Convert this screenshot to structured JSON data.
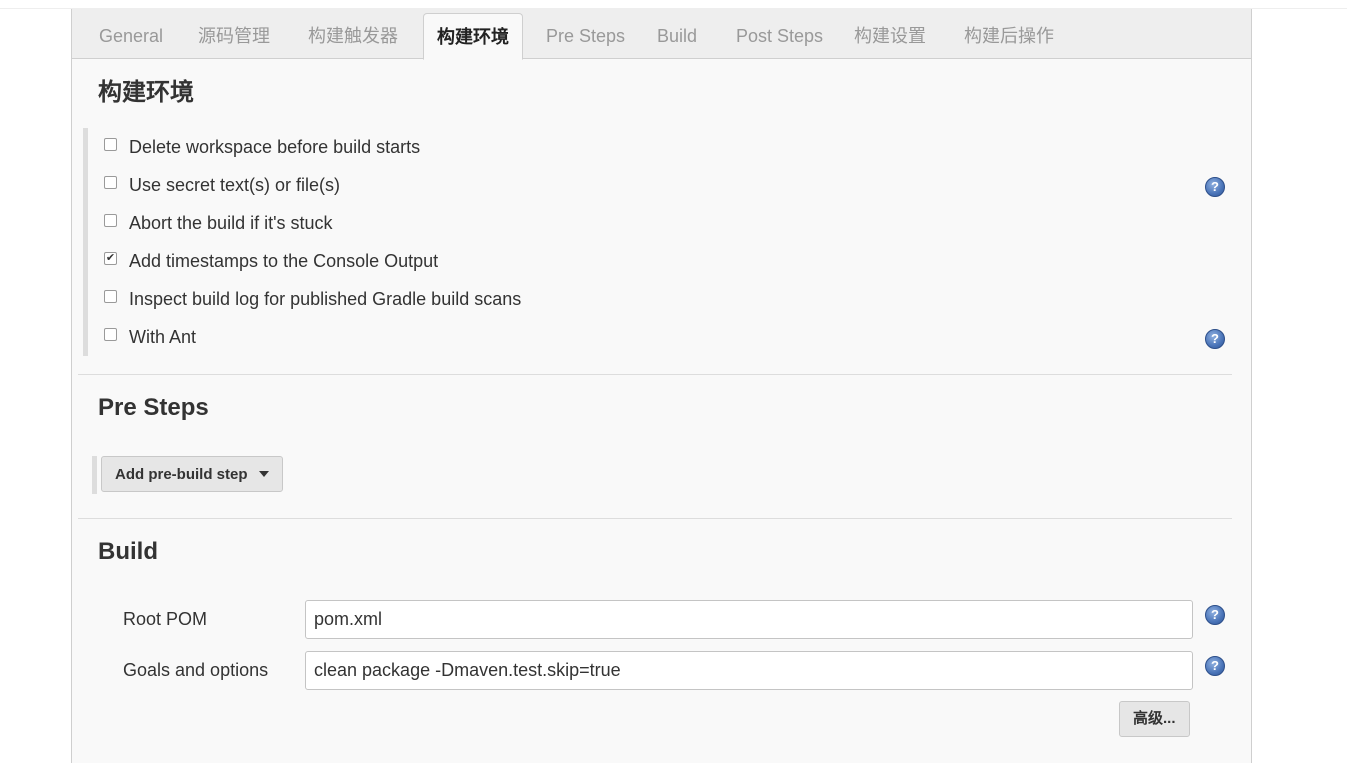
{
  "tabs": [
    {
      "label": "General",
      "active": false
    },
    {
      "label": "源码管理",
      "active": false
    },
    {
      "label": "构建触发器",
      "active": false
    },
    {
      "label": "构建环境",
      "active": true
    },
    {
      "label": "Pre Steps",
      "active": false
    },
    {
      "label": "Build",
      "active": false
    },
    {
      "label": "Post Steps",
      "active": false
    },
    {
      "label": "构建设置",
      "active": false
    },
    {
      "label": "构建后操作",
      "active": false
    }
  ],
  "build_env": {
    "title": "构建环境",
    "options": [
      {
        "label": "Delete workspace before build starts",
        "checked": false
      },
      {
        "label": "Use secret text(s) or file(s)",
        "checked": false
      },
      {
        "label": "Abort the build if it's stuck",
        "checked": false
      },
      {
        "label": "Add timestamps to the Console Output",
        "checked": true
      },
      {
        "label": "Inspect build log for published Gradle build scans",
        "checked": false
      },
      {
        "label": "With Ant",
        "checked": false
      }
    ]
  },
  "pre_steps": {
    "title": "Pre Steps",
    "add_button_label": "Add pre-build step"
  },
  "build": {
    "title": "Build",
    "root_pom_label": "Root POM",
    "root_pom_value": "pom.xml",
    "goals_label": "Goals and options",
    "goals_value": "clean package -Dmaven.test.skip=true",
    "advanced_label": "高级..."
  },
  "help_icon_glyph": "?",
  "colors": {
    "panel_bg": "#f9f9f9",
    "tabbar_bg": "#eeeeee",
    "help_icon": "#4a74b8",
    "button_bg": "#e6e6e6"
  }
}
